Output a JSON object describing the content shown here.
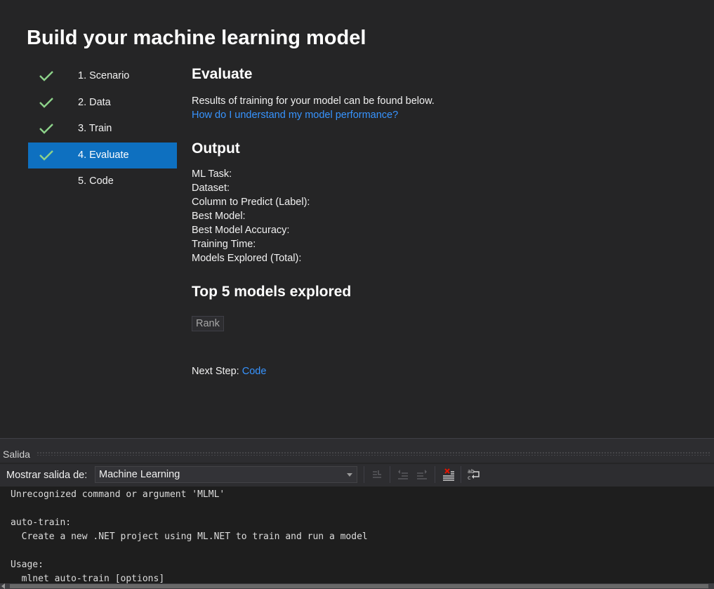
{
  "builder": {
    "title": "Build your machine learning model",
    "steps": [
      {
        "label": "1. Scenario",
        "completed": true,
        "active": false
      },
      {
        "label": "2. Data",
        "completed": true,
        "active": false
      },
      {
        "label": "3. Train",
        "completed": true,
        "active": false
      },
      {
        "label": "4. Evaluate",
        "completed": true,
        "active": true
      },
      {
        "label": "5. Code",
        "completed": false,
        "active": false
      }
    ],
    "evaluate": {
      "heading": "Evaluate",
      "description": "Results of training for your model can be found below.",
      "help_link": "How do I understand my model performance?"
    },
    "output": {
      "heading": "Output",
      "fields": [
        "ML Task:",
        "Dataset:",
        "Column to Predict (Label):",
        "Best Model:",
        "Best Model Accuracy:",
        "Training Time:",
        "Models Explored (Total):"
      ]
    },
    "top_models": {
      "heading": "Top 5 models explored",
      "columns": [
        "Rank"
      ]
    },
    "next_step": {
      "label": "Next Step:",
      "link": "Code"
    }
  },
  "output_pane": {
    "title": "Salida",
    "show_output_from_label": "Mostrar salida de:",
    "source_selected": "Machine Learning",
    "toolbar_icons": [
      "go-to-error-icon",
      "previous-message-icon",
      "next-message-icon",
      "clear-all-icon",
      "word-wrap-icon"
    ],
    "console_lines": [
      "Unrecognized command or argument 'MLML'",
      "",
      "auto-train:",
      "  Create a new .NET project using ML.NET to train and run a model",
      "",
      "Usage:",
      "  mlnet auto-train [options]"
    ]
  },
  "colors": {
    "background": "#252526",
    "active_step": "#0e70c0",
    "link": "#3794ff",
    "check": "#8dd28a"
  }
}
